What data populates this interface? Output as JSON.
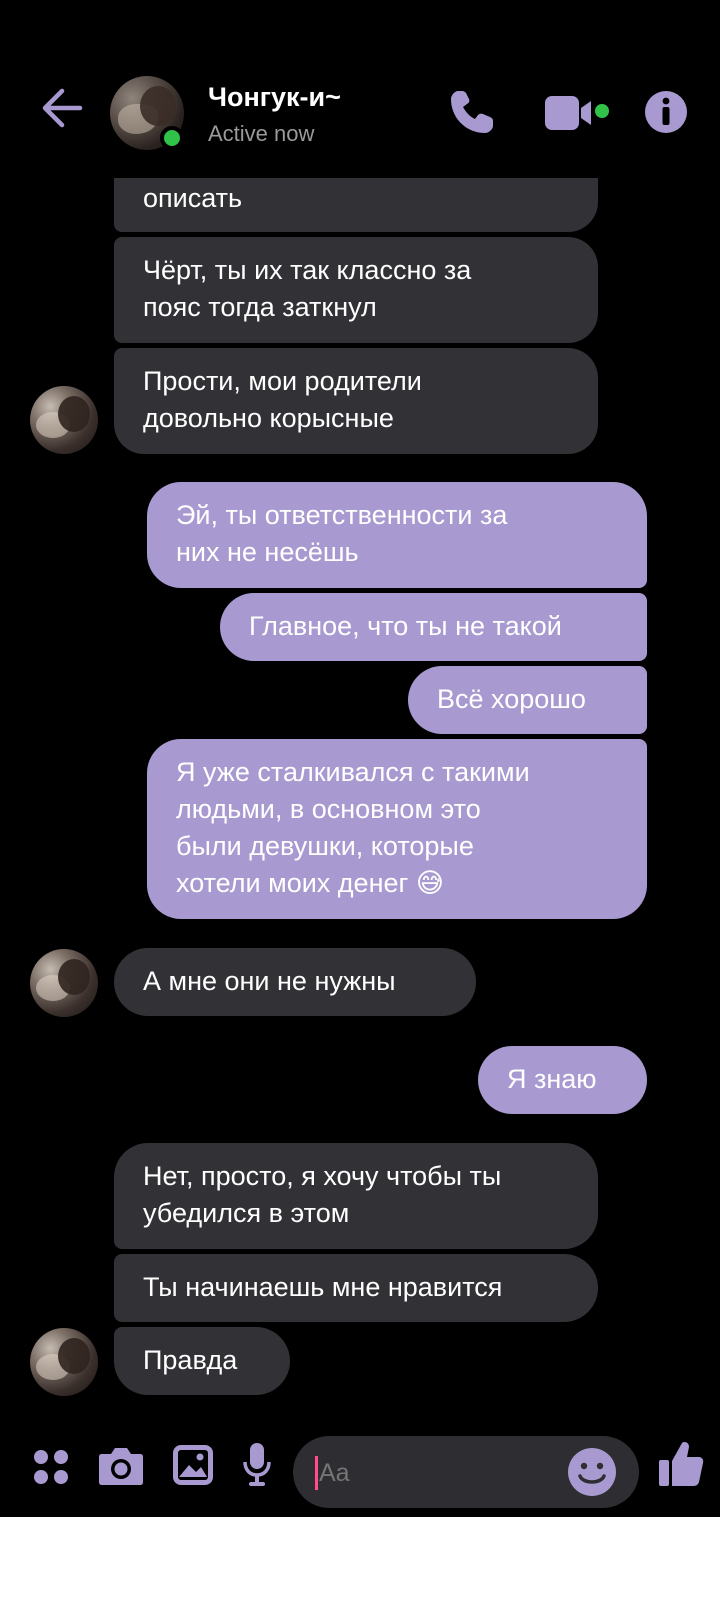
{
  "header": {
    "contact_name": "Чонгук-и~",
    "status": "Active now",
    "back_icon": "arrow-left-icon",
    "call_icon": "phone-icon",
    "video_icon": "video-camera-icon",
    "info_icon": "info-icon"
  },
  "colors": {
    "accent": "#a89ad0",
    "incoming_bubble": "#323136",
    "online": "#31c24a",
    "background": "#000000"
  },
  "messages": [
    {
      "dir": "in",
      "text": "описать"
    },
    {
      "dir": "in",
      "text": "Чёрт, ты их так классно за\nпояс тогда заткнул"
    },
    {
      "dir": "in",
      "text": "Прости, мои родители\nдовольно корысные"
    },
    {
      "dir": "out",
      "text": "Эй, ты  ответственности за\nних не несёшь"
    },
    {
      "dir": "out",
      "text": "Главное, что ты не такой"
    },
    {
      "dir": "out",
      "text": "Всё хорошо"
    },
    {
      "dir": "out",
      "text": "Я уже сталкивался с такими\nлюдьми, в основном это\nбыли девушки, которые\nхотели моих денег 😅"
    },
    {
      "dir": "in",
      "text": "А мне они не нужны"
    },
    {
      "dir": "out",
      "text": "Я знаю"
    },
    {
      "dir": "in",
      "text": "Нет, просто, я хочу чтобы ты\nубедился в этом"
    },
    {
      "dir": "in",
      "text": "Ты начинаешь мне нравится"
    },
    {
      "dir": "in",
      "text": "Правда"
    }
  ],
  "composer": {
    "placeholder": "Aa",
    "icons": [
      "apps-icon",
      "camera-icon",
      "gallery-icon",
      "microphone-icon",
      "emoji-icon",
      "thumbs-up-icon"
    ]
  }
}
